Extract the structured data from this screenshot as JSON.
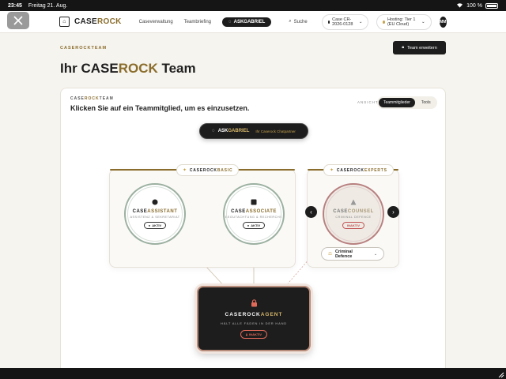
{
  "status": {
    "time": "23:45",
    "date": "Freitag 21. Aug.",
    "battery": "100 %"
  },
  "nav": {
    "brand_a": "CASE",
    "brand_b": "ROCK",
    "links": [
      "Caseverwaltung",
      "Teambriefing"
    ],
    "ask_a": "ASK",
    "ask_b": "GABRIEL",
    "search": "Suche",
    "case_pill": "Case CR-2026-0128",
    "hosting_pill": "Hosting: Tier 1 (EU Cloud)",
    "avatar": "MM"
  },
  "header": {
    "overline": "CASEROCKTEAM",
    "title_a": "Ihr CASE",
    "title_b": "ROCK",
    "title_c": " Team",
    "expand_button": "Team erweitern"
  },
  "card": {
    "over_a": "CASE",
    "over_b": "ROCK",
    "over_c": "TEAM",
    "subtitle": "Klicken Sie auf ein Teammitglied, um es einzusetzen.",
    "view_label": "ANSICHT",
    "toggle": {
      "active": "Teammitglieder",
      "inactive": "Tools"
    },
    "chat": {
      "a": "ASK",
      "b": "GABRIEL",
      "sub": "Ihr Caserock Chatpartner"
    }
  },
  "basic": {
    "label_a": "CASEROCK",
    "label_b": "BASIC",
    "members": [
      {
        "name_a": "CASE",
        "name_b": "ASSISTANT",
        "desc": "ASSISTENZ & SEKRETARIAT",
        "badge": "AKTIV"
      },
      {
        "name_a": "CASE",
        "name_b": "ASSOCIATE",
        "desc": "BEGUTACHTUNG & RECHERCHE",
        "badge": "AKTIV"
      }
    ]
  },
  "experts": {
    "label_a": "CASEROCK",
    "label_b": "EXPERTS",
    "member": {
      "name_a": "CASE",
      "name_b": "COUNSEL",
      "desc": "CRIMINAL DEFENCE",
      "badge": "INAKTIV"
    },
    "select": "Criminal Defence"
  },
  "agent": {
    "name_a": "CASEROCK",
    "name_b": "AGENT",
    "desc": "HÄLT ALLE FÄDEN IN DER HAND",
    "badge": "INAKTIV"
  }
}
